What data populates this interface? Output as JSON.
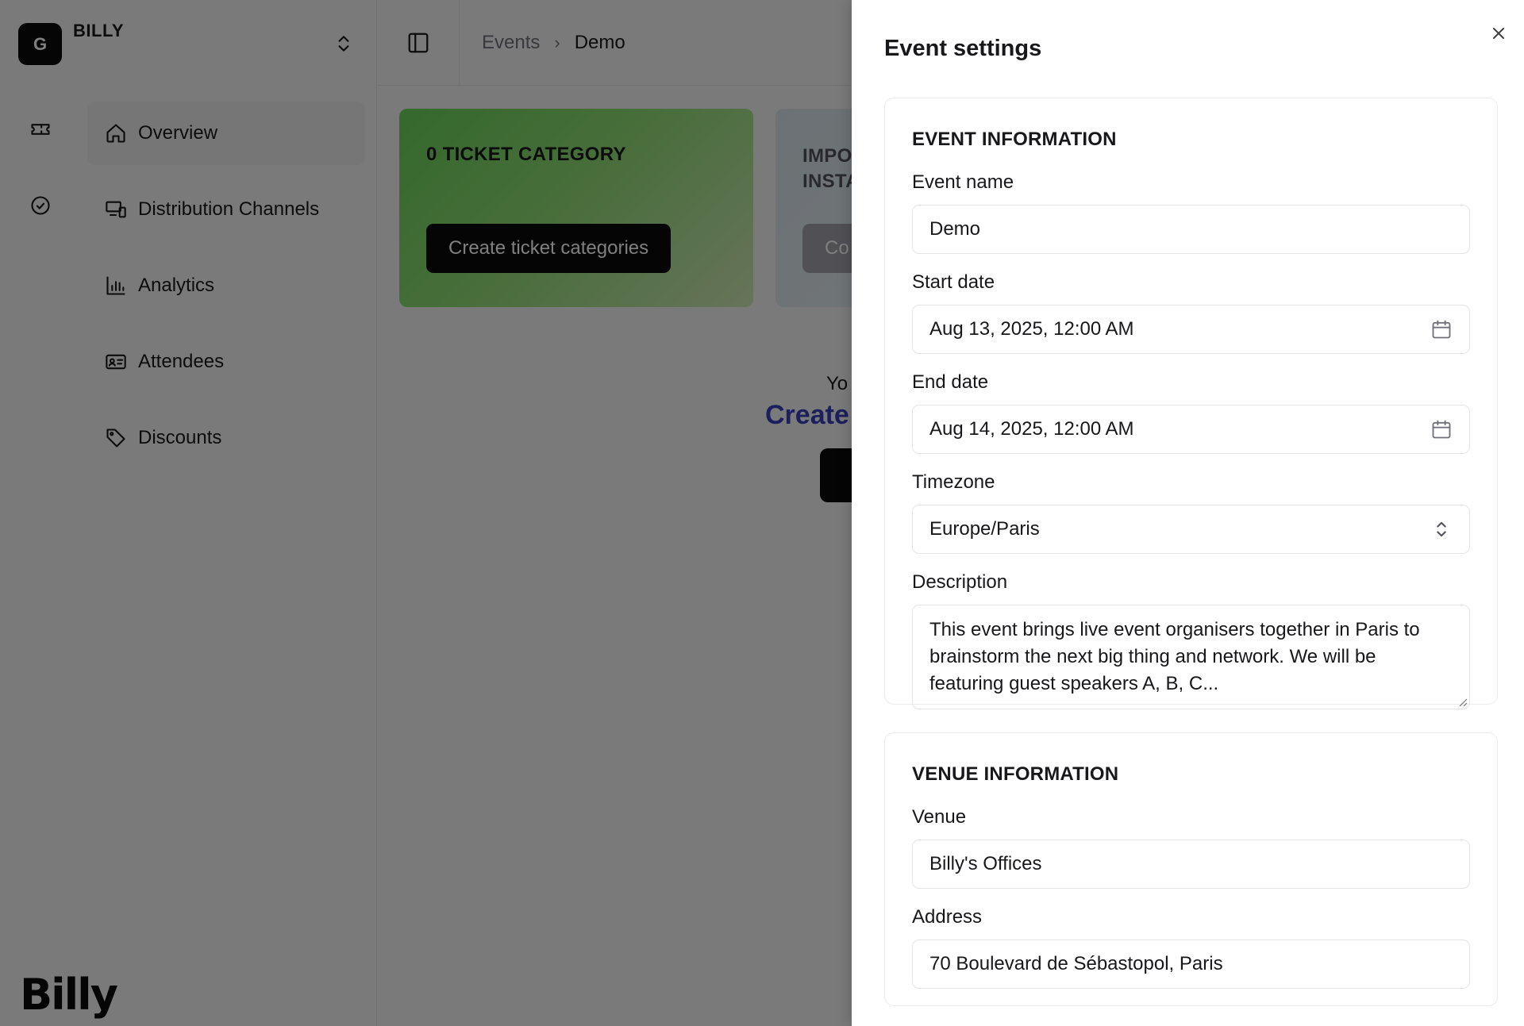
{
  "org": {
    "initial": "G",
    "name": "BILLY"
  },
  "nav": {
    "items": [
      {
        "label": "Overview",
        "icon": "home-icon",
        "active": true
      },
      {
        "label": "Distribution Channels",
        "icon": "devices-icon"
      },
      {
        "label": "Analytics",
        "icon": "bar-chart-icon"
      },
      {
        "label": "Attendees",
        "icon": "id-card-icon"
      },
      {
        "label": "Discounts",
        "icon": "tag-icon"
      }
    ]
  },
  "brand": {
    "logo_text": "Billy"
  },
  "breadcrumb": {
    "parent": "Events",
    "current": "Demo"
  },
  "cards": {
    "ticket": {
      "title": "0 TICKET CATEGORY",
      "button": "Create ticket categories"
    },
    "import": {
      "title_line1": "IMPO",
      "title_line2": "INSTA",
      "button": "Co"
    }
  },
  "empty_state": {
    "text": "Yo",
    "link": "Create"
  },
  "panel": {
    "title": "Event settings",
    "event_info": {
      "heading": "EVENT INFORMATION",
      "event_name": {
        "label": "Event name",
        "value": "Demo"
      },
      "start_date": {
        "label": "Start date",
        "value": "Aug 13, 2025, 12:00 AM"
      },
      "end_date": {
        "label": "End date",
        "value": "Aug 14, 2025, 12:00 AM"
      },
      "timezone": {
        "label": "Timezone",
        "value": "Europe/Paris"
      },
      "description": {
        "label": "Description",
        "value": "This event brings live event organisers together in Paris to brainstorm the next big thing and network. We will be featuring guest speakers A, B, C..."
      }
    },
    "venue_info": {
      "heading": "VENUE INFORMATION",
      "venue": {
        "label": "Venue",
        "value": "Billy's Offices"
      },
      "address": {
        "label": "Address",
        "value": "70 Boulevard de Sébastopol, Paris"
      }
    }
  },
  "colors": {
    "accent_green": "#6ad25a",
    "link_blue": "#3b3fb8",
    "dark": "#0a0a0a"
  }
}
